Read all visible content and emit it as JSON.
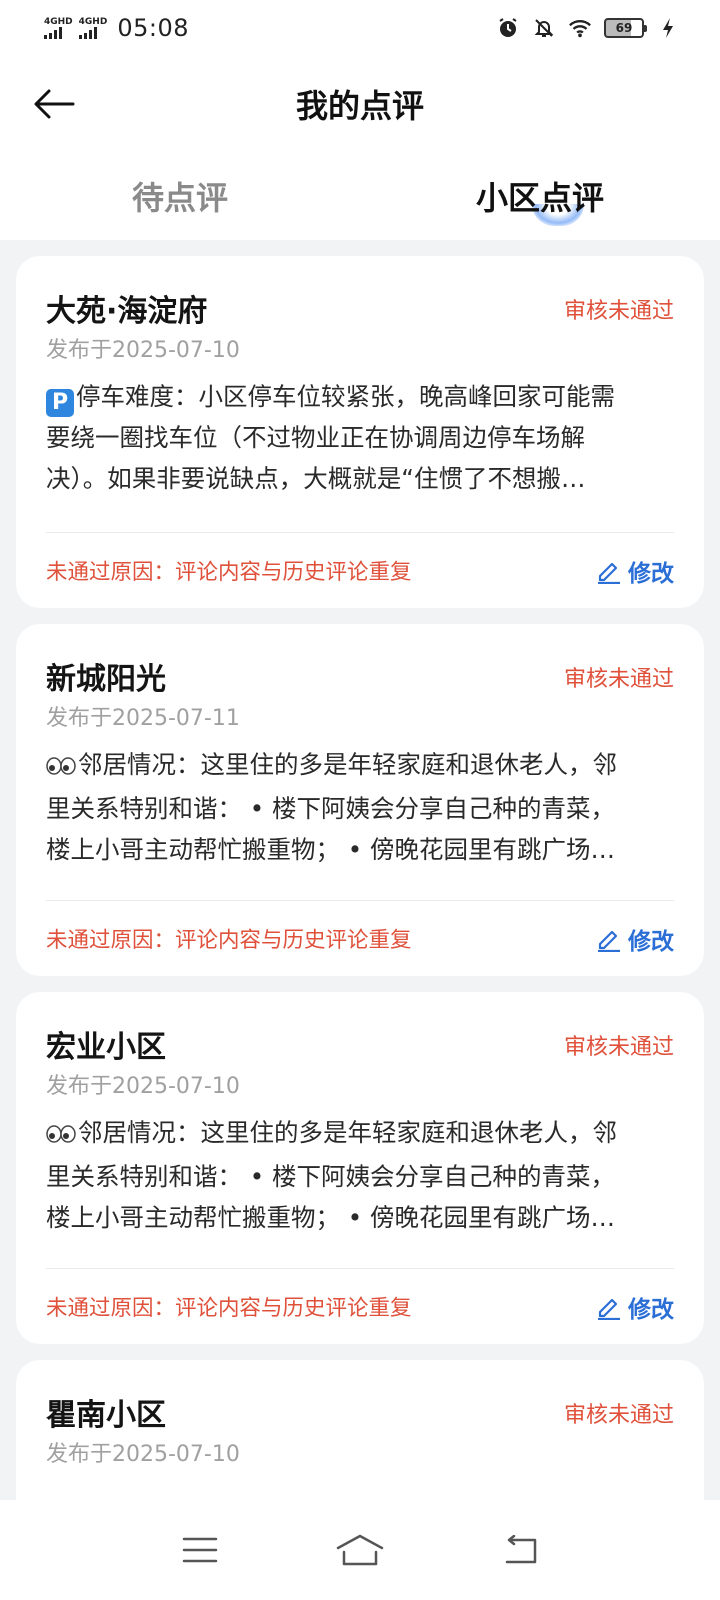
{
  "status_bar": {
    "sim1": "4GHD",
    "sim2": "4GHD",
    "time": "05:08",
    "battery": "69"
  },
  "header": {
    "title": "我的点评"
  },
  "tabs": [
    {
      "label": "待点评",
      "active": false
    },
    {
      "label": "小区点评",
      "active": true
    }
  ],
  "colors": {
    "status_red": "#e0513b",
    "accent_blue": "#2b6fd6"
  },
  "reviews": [
    {
      "name": "大苑·海淀府",
      "status": "审核未通过",
      "date": "发布于2025-07-10",
      "icon": "parking-emoji",
      "lines": [
        "停车难度：小区停车位较紧张，晚高峰回家可能需",
        "要绕一圈找车位（不过物业正在协调周边停车场解",
        "决）。如果非要说缺点，大概就是“住惯了不想搬…"
      ],
      "reason": "未通过原因：评论内容与历史评论重复",
      "edit_label": "修改"
    },
    {
      "name": "新城阳光",
      "status": "审核未通过",
      "date": "发布于2025-07-11",
      "icon": "eyes-emoji",
      "lines": [
        "邻居情况：这里住的多是年轻家庭和退休老人，邻",
        "里关系特别和谐： • 楼下阿姨会分享自己种的青菜，",
        "楼上小哥主动帮忙搬重物； • 傍晚花园里有跳广场…"
      ],
      "reason": "未通过原因：评论内容与历史评论重复",
      "edit_label": "修改"
    },
    {
      "name": "宏业小区",
      "status": "审核未通过",
      "date": "发布于2025-07-10",
      "icon": "eyes-emoji",
      "lines": [
        "邻居情况：这里住的多是年轻家庭和退休老人，邻",
        "里关系特别和谐： • 楼下阿姨会分享自己种的青菜，",
        "楼上小哥主动帮忙搬重物； • 傍晚花园里有跳广场…"
      ],
      "reason": "未通过原因：评论内容与历史评论重复",
      "edit_label": "修改"
    },
    {
      "name": "瞿南小区",
      "status": "审核未通过",
      "date": "发布于2025-07-10"
    }
  ]
}
